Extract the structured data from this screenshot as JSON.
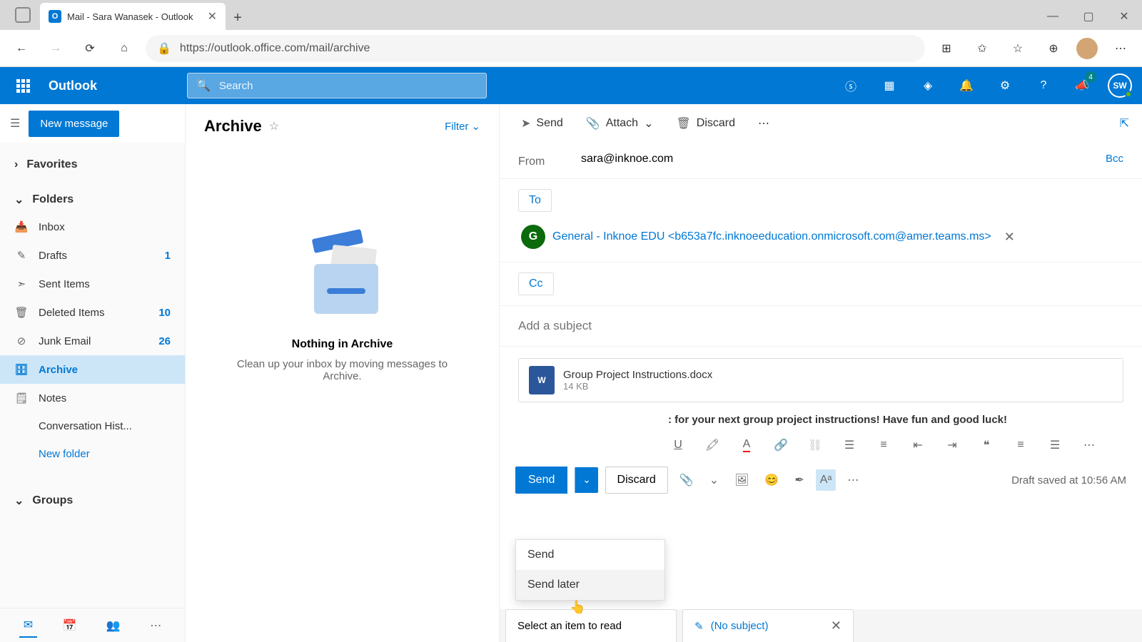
{
  "browser": {
    "tab_title": "Mail - Sara Wanasek - Outlook",
    "url": "https://outlook.office.com/mail/archive"
  },
  "header": {
    "brand": "Outlook",
    "search_placeholder": "Search",
    "notification_count": "4",
    "avatar_initials": "SW"
  },
  "nav": {
    "new_message": "New message",
    "favorites": "Favorites",
    "folders": "Folders",
    "items": [
      {
        "label": "Inbox",
        "count": ""
      },
      {
        "label": "Drafts",
        "count": "1"
      },
      {
        "label": "Sent Items",
        "count": ""
      },
      {
        "label": "Deleted Items",
        "count": "10"
      },
      {
        "label": "Junk Email",
        "count": "26"
      },
      {
        "label": "Archive",
        "count": ""
      },
      {
        "label": "Notes",
        "count": ""
      },
      {
        "label": "Conversation Hist...",
        "count": ""
      }
    ],
    "new_folder": "New folder",
    "groups": "Groups"
  },
  "list": {
    "title": "Archive",
    "filter": "Filter",
    "empty_title": "Nothing in Archive",
    "empty_sub": "Clean up your inbox by moving messages to Archive."
  },
  "compose_toolbar": {
    "send": "Send",
    "attach": "Attach",
    "discard": "Discard"
  },
  "compose": {
    "from_label": "From",
    "from_value": "sara@inknoe.com",
    "to_label": "To",
    "cc_label": "Cc",
    "bcc_label": "Bcc",
    "recipient_initial": "G",
    "recipient_text": "General - Inknoe EDU <b653a7fc.inknoeeducation.onmicrosoft.com@amer.teams.ms>",
    "subject_placeholder": "Add a subject",
    "attachment_name": "Group Project Instructions.docx",
    "attachment_size": "14 KB",
    "body_snippet": ": for your next group project instructions! Have fun and good luck!",
    "send_btn": "Send",
    "discard_btn": "Discard",
    "draft_status": "Draft saved at 10:56 AM"
  },
  "send_menu": {
    "send": "Send",
    "send_later": "Send later"
  },
  "bottom_tabs": {
    "reading": "Select an item to read",
    "draft": "(No subject)"
  }
}
